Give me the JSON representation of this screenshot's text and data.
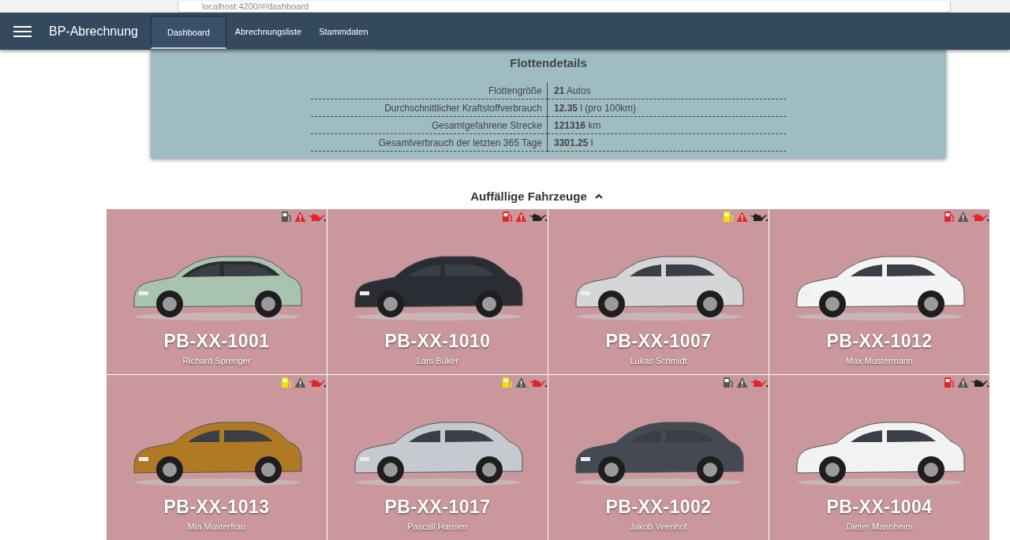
{
  "browser": {
    "url": "localhost:4200/#/dashboard"
  },
  "app_bar": {
    "title": "BP-Abrechnung",
    "tabs": [
      {
        "label": "Dashboard",
        "selected": true
      },
      {
        "label": "Abrechnungsliste",
        "selected": false
      },
      {
        "label": "Stammdaten",
        "selected": false
      }
    ]
  },
  "fleet_details": {
    "title": "Flottendetails",
    "rows": [
      {
        "label": "Flottengröße",
        "value": "**21** Autos"
      },
      {
        "label": "Durchschnittlicher Kraftstoffverbrauch",
        "value": "**12.35** l (pro 100km)"
      },
      {
        "label": "Gesamtgefahrene Strecke",
        "value": "**121316** km"
      },
      {
        "label": "Gesamtverbrauch der letzten 365 Tage",
        "value": "**3301.25** l"
      }
    ]
  },
  "vehicles": {
    "title": "Auffällige Fahrzeuge",
    "expanded": true,
    "cards": [
      {
        "plate": "PB-XX-1001",
        "driver": "Richard Sprenger",
        "image": {
          "kind": "picture"
        },
        "alerts": [
          {
            "kind": "fuel",
            "color": "#555555"
          },
          {
            "kind": "warning",
            "color": "#e3242b"
          },
          {
            "kind": "oil",
            "color": "#e3242b"
          }
        ]
      },
      {
        "plate": "PB-XX-1010",
        "driver": "Lars Büker",
        "image": {
          "kind": "picture"
        },
        "alerts": [
          {
            "kind": "fuel",
            "color": "#e3242b"
          },
          {
            "kind": "warning",
            "color": "#e3242b"
          },
          {
            "kind": "oil",
            "color": "#222222"
          }
        ]
      },
      {
        "plate": "PB-XX-1007",
        "driver": "Lukas Schmidt",
        "image": {
          "kind": "picture"
        },
        "alerts": [
          {
            "kind": "fuel",
            "color": "#f5e100"
          },
          {
            "kind": "warning",
            "color": "#e3242b"
          },
          {
            "kind": "oil",
            "color": "#222222"
          }
        ]
      },
      {
        "plate": "PB-XX-1012",
        "driver": "Max Mustermann",
        "image": {
          "kind": "picture"
        },
        "alerts": [
          {
            "kind": "fuel",
            "color": "#e3242b"
          },
          {
            "kind": "warning",
            "color": "#555555"
          },
          {
            "kind": "oil",
            "color": "#e3242b"
          }
        ]
      },
      {
        "plate": "PB-XX-1013",
        "driver": "Mia Musterfrau",
        "image": {
          "kind": "picture"
        },
        "alerts": [
          {
            "kind": "fuel",
            "color": "#f5e100"
          },
          {
            "kind": "warning",
            "color": "#555555"
          },
          {
            "kind": "oil",
            "color": "#e3242b"
          }
        ]
      },
      {
        "plate": "PB-XX-1017",
        "driver": "Pascall Hansen",
        "image": {
          "kind": "picture"
        },
        "alerts": [
          {
            "kind": "fuel",
            "color": "#f5e100"
          },
          {
            "kind": "warning",
            "color": "#555555"
          },
          {
            "kind": "oil",
            "color": "#e3242b"
          }
        ]
      },
      {
        "plate": "PB-XX-1002",
        "driver": "Jakob Veenhof",
        "image": {
          "kind": "picture"
        },
        "alerts": [
          {
            "kind": "fuel",
            "color": "#555555"
          },
          {
            "kind": "warning",
            "color": "#555555"
          },
          {
            "kind": "oil",
            "color": "#e3242b"
          }
        ]
      },
      {
        "plate": "PB-XX-1004",
        "driver": "Dieter Mannheim",
        "image": {
          "kind": "picture"
        },
        "alerts": [
          {
            "kind": "fuel",
            "color": "#e3242b"
          },
          {
            "kind": "warning",
            "color": "#555555"
          },
          {
            "kind": "oil",
            "color": "#222222"
          }
        ]
      }
    ]
  }
}
